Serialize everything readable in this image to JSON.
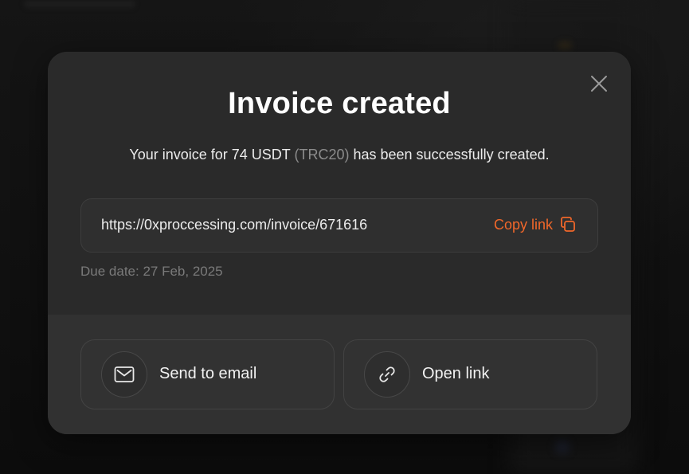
{
  "modal": {
    "title": "Invoice created",
    "subtitle_prefix": "Your invoice for 74 USDT ",
    "subtitle_network": "(TRC20)",
    "subtitle_suffix": " has been successfully created.",
    "invoice_url": "https://0xproccessing.com/invoice/671616",
    "copy_label": "Copy link",
    "due_date": "Due date: 27 Feb, 2025",
    "actions": [
      {
        "label": "Send to email",
        "icon": "envelope-icon"
      },
      {
        "label": "Open link",
        "icon": "link-icon"
      }
    ]
  },
  "colors": {
    "accent": "#f0672a",
    "modal_bg": "#2a2a2a",
    "modal_footer_bg": "#313131",
    "muted_text": "#7a7a7a"
  }
}
